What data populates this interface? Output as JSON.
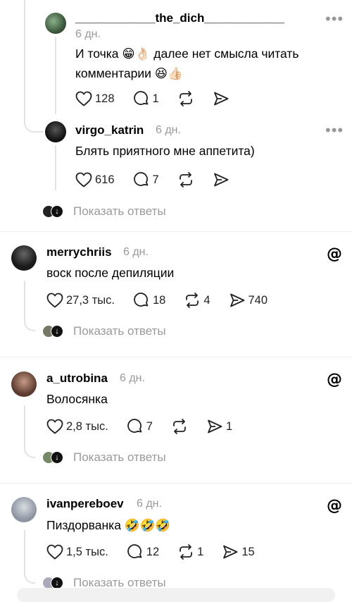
{
  "comments": [
    {
      "username": "____________the_dich____________",
      "time": "6 дн.",
      "text_line1": "И точка 😁👌🏻 далее нет смысла читать",
      "text_line2": "комментарии 😆👍🏻",
      "likes": "128",
      "replies": "1",
      "reposts": "",
      "shares": ""
    },
    {
      "username": "virgo_katrin",
      "time": "6 дн.",
      "text": "Блять приятного мне аппетита)",
      "likes": "616",
      "replies": "7",
      "reposts": "",
      "shares": ""
    },
    {
      "username": "merrychriis",
      "time": "6 дн.",
      "text": "воск после депиляции",
      "likes": "27,3 тыс.",
      "replies": "18",
      "reposts": "4",
      "shares": "740"
    },
    {
      "username": "a_utrobina",
      "time": "6 дн.",
      "text": "Волосянка",
      "likes": "2,8 тыс.",
      "replies": "7",
      "reposts": "",
      "shares": "1"
    },
    {
      "username": "ivanpereboev",
      "time": "6 дн.",
      "text": "Пиздорванка 🤣🤣🤣",
      "likes": "1,5 тыс.",
      "replies": "12",
      "reposts": "1",
      "shares": "15"
    }
  ],
  "show_replies_label": "Показать ответы",
  "more_label": "•••",
  "icons": {
    "like": "heart-icon",
    "reply": "comment-icon",
    "repost": "repost-icon",
    "share": "send-icon",
    "brand": "threads-logo-icon"
  },
  "colors": {
    "muted": "#999999",
    "line": "#e3e3e3",
    "text": "#000000"
  }
}
